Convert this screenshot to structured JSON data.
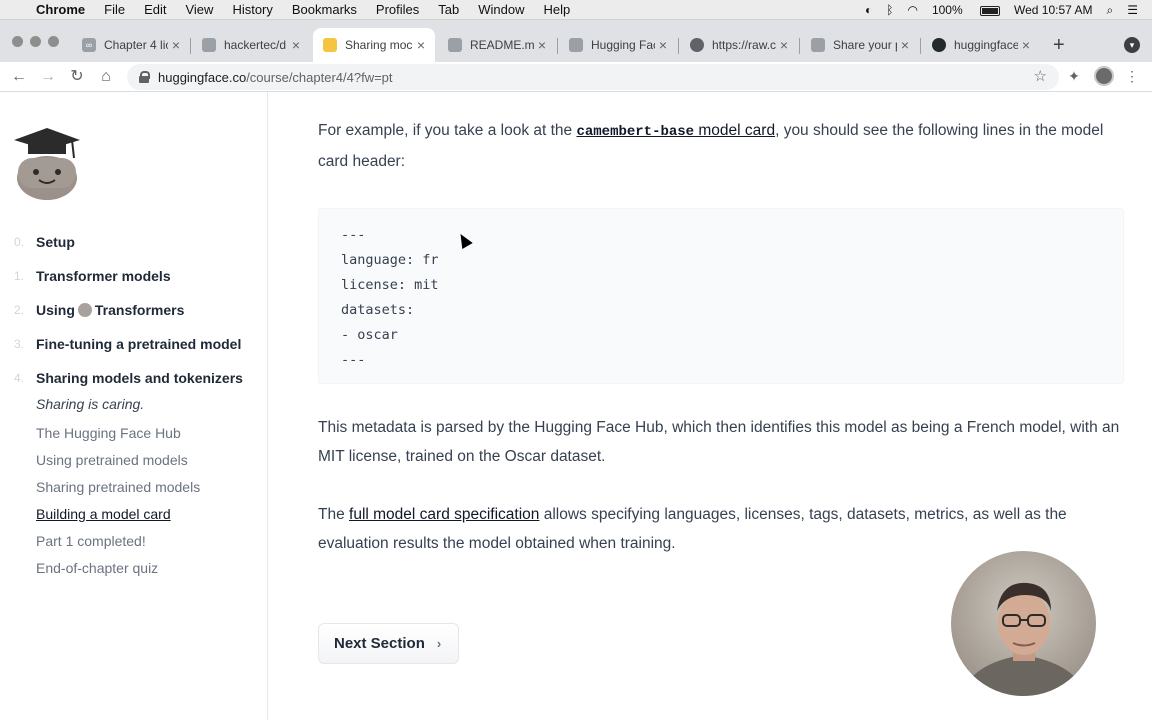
{
  "menubar": {
    "app": "Chrome",
    "items": [
      "File",
      "Edit",
      "View",
      "History",
      "Bookmarks",
      "Profiles",
      "Tab",
      "Window",
      "Help"
    ],
    "battery": "100%",
    "clock": "Wed 10:57 AM"
  },
  "tabs": [
    {
      "title": "Chapter 4 lic",
      "icon": "infinity-icon"
    },
    {
      "title": "hackertec/d",
      "icon": "page-icon"
    },
    {
      "title": "Sharing moc",
      "icon": "hugging-face-icon",
      "active": true
    },
    {
      "title": "README.mc",
      "icon": "page-icon"
    },
    {
      "title": "Hugging Fac",
      "icon": "page-icon"
    },
    {
      "title": "https://raw.c",
      "icon": "globe-icon"
    },
    {
      "title": "Share your p",
      "icon": "page-icon"
    },
    {
      "title": "huggingface",
      "icon": "github-icon"
    }
  ],
  "omnibox": {
    "host": "huggingface.co",
    "path": "/course/chapter4/4?fw=pt"
  },
  "sidebar": {
    "chapters": [
      {
        "num": "0.",
        "label": "Setup"
      },
      {
        "num": "1.",
        "label": "Transformer models"
      },
      {
        "num": "2.",
        "label_pre": "Using",
        "label_post": "Transformers"
      },
      {
        "num": "3.",
        "label": "Fine-tuning a pretrained model"
      },
      {
        "num": "4.",
        "label": "Sharing models and tokenizers"
      }
    ],
    "sections": [
      {
        "label": "Sharing is caring."
      },
      {
        "label": "The Hugging Face Hub"
      },
      {
        "label": "Using pretrained models"
      },
      {
        "label": "Sharing pretrained models"
      },
      {
        "label": "Building a model card"
      },
      {
        "label": "Part 1 completed!"
      },
      {
        "label": "End-of-chapter quiz"
      }
    ]
  },
  "content": {
    "p1_prefix": "For example, if you take a look at the ",
    "p1_code": "camembert-base",
    "p1_link_rest": " model card",
    "p1_suffix": ", you should see the following lines in the model card header:",
    "code_lines": [
      "---",
      "language: fr",
      "license: mit",
      "datasets:",
      "- oscar",
      "---"
    ],
    "p2": "This metadata is parsed by the Hugging Face Hub, which then identifies this model as being a French model, with an MIT license, trained on the Oscar dataset.",
    "p3_prefix": "The ",
    "p3_link": "full model card specification",
    "p3_suffix": " allows specifying languages, licenses, tags, datasets, metrics, as well as the evaluation results the model obtained when training.",
    "next_label": "Next Section"
  }
}
